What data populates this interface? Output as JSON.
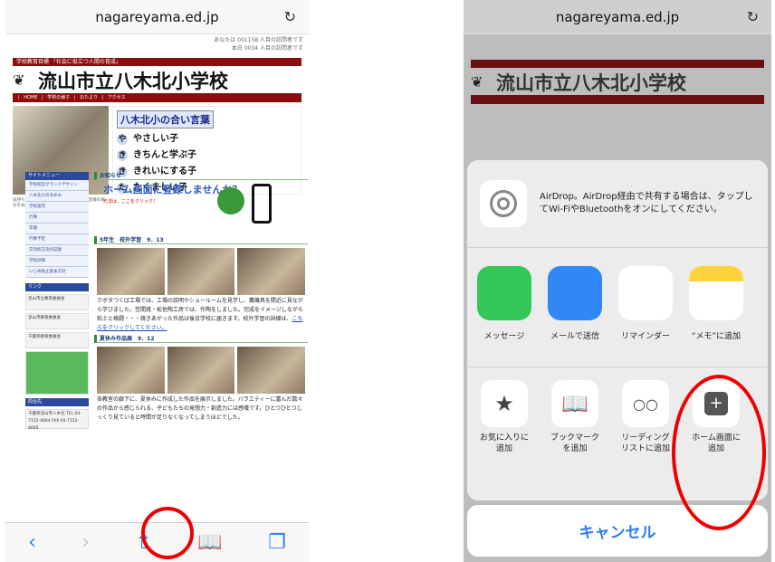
{
  "left": {
    "url": "nagareyama.ed.jp",
    "counter_line1": "あなたは 001158 人目の訪問者です",
    "counter_line2": "本日 0034 人目の訪問者です",
    "motto_bar": "学校教育目標 「社会に役立つ人間の育成」",
    "school_name": "流山市立八木北小学校",
    "nav": "| HOME | 学校の様子 | おたより | アクセス",
    "motto_title": "八木北小の合い言葉",
    "motto_lines": [
      {
        "k": "や",
        "t": "やさしい子"
      },
      {
        "k": "き",
        "t": "きちんと学ぶ子"
      },
      {
        "k": "き",
        "t": "きれいにする子"
      },
      {
        "k": "た",
        "t": "たくましい子"
      }
    ],
    "photo_caption": "気持ちよく1学期をスタートするために、皆様の協力をお願いいたします。",
    "sidebar_head": "サイトメニュー",
    "sidebar_items": [
      "学校経営グランドデザイン",
      "八木北小のあゆみ",
      "学校案内",
      "行事",
      "年間",
      "行事予定",
      "交流校交流の記録",
      "学校評価",
      "いじめ防止基本方針"
    ],
    "links_head": "リンク",
    "links": [
      "流山市立教育委員会",
      "流山市教育委員会",
      "千葉県教育委員会"
    ],
    "contact_head": "問合先",
    "contact": "千葉県流山市八木北 TEL 04-7152-4604 FAX 04-7152-4605",
    "notice_head": "お知らせ",
    "home_text": "ホーム画面に登録しませんか？",
    "home_small": "方法は、ここをクリック！",
    "sec1": "5年生　校外学習　9．13",
    "txt1": "クボタつくば工場では、工場の説明やショールームを見学し、農機具を間近に見ながら学びました。笠間焼・松佐陶工房では、作陶をしました。完成をイメージしながら粘土と格闘・・・焼きあがった作品は後日学校に届きます。校外学習の詳細は、",
    "txt1_link": "こちらをクリックしてください。",
    "sec2": "夏休み作品展　9．12",
    "txt2": "各教室の廊下に、夏休みに作成した作品を展示しました。バラエティーに富んだ数々の作品から感じられる、子どもたちの発想力・創造力には感嘆です。ひとつひとつじっくり見ていると時間が足りなくなってしまうほどでした。",
    "toolbar": {
      "back": "‹",
      "forward": "›",
      "share": "⇧",
      "bookmarks": "📖",
      "tabs": "❐"
    }
  },
  "right": {
    "url": "nagareyama.ed.jp",
    "airdrop_text": "AirDrop。AirDrop経由で共有する場合は、タップしてWi-FiやBluetoothをオンにしてください。",
    "apps": [
      {
        "label": "メッセージ",
        "color": "#35c759"
      },
      {
        "label": "メールで送信",
        "color": "#2f88f5"
      },
      {
        "label": "リマインダー",
        "color": "#ffffff"
      },
      {
        "label": "“メモ”に追加",
        "color": "#ffd43b"
      }
    ],
    "actions": [
      {
        "label": "お気に入りに追加",
        "icon": "★"
      },
      {
        "label": "ブックマークを追加",
        "icon": "📖"
      },
      {
        "label": "リーディングリストに追加",
        "icon": "○○"
      },
      {
        "label": "ホーム画面に追加",
        "icon": "+"
      }
    ],
    "cancel": "キャンセル"
  },
  "colors": {
    "highlight": "#e00000",
    "ios_blue": "#2e7bf6",
    "site_red": "#8b0d0d"
  }
}
